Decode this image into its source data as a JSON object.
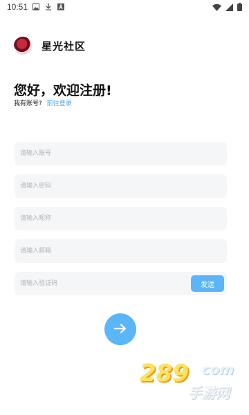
{
  "status_bar": {
    "time": "10:51",
    "left_icons": [
      "image-icon",
      "download-icon",
      "font-icon"
    ],
    "right_icons": [
      "wifi-icon",
      "signal-icon",
      "battery-icon"
    ]
  },
  "brand": {
    "name": "星光社区",
    "logo": "app-logo"
  },
  "greeting": "您好，欢迎注册!",
  "login_prompt": {
    "text": "我有账号?",
    "link": "前往登录"
  },
  "fields": {
    "account": {
      "placeholder": "请输入账号",
      "value": ""
    },
    "password": {
      "placeholder": "请输入密码",
      "value": ""
    },
    "nickname": {
      "placeholder": "请输入昵称",
      "value": ""
    },
    "email": {
      "placeholder": "请输入邮箱",
      "value": ""
    },
    "code": {
      "placeholder": "请输入验证码",
      "value": ""
    }
  },
  "send_code_label": "发送",
  "submit": {
    "icon": "arrow-right-icon"
  },
  "watermark": {
    "number": "289",
    "domain": "com",
    "text": "手游网"
  },
  "colors": {
    "accent": "#5bb6f7",
    "link": "#3fa4f4",
    "field_bg": "#f5f6f8"
  }
}
